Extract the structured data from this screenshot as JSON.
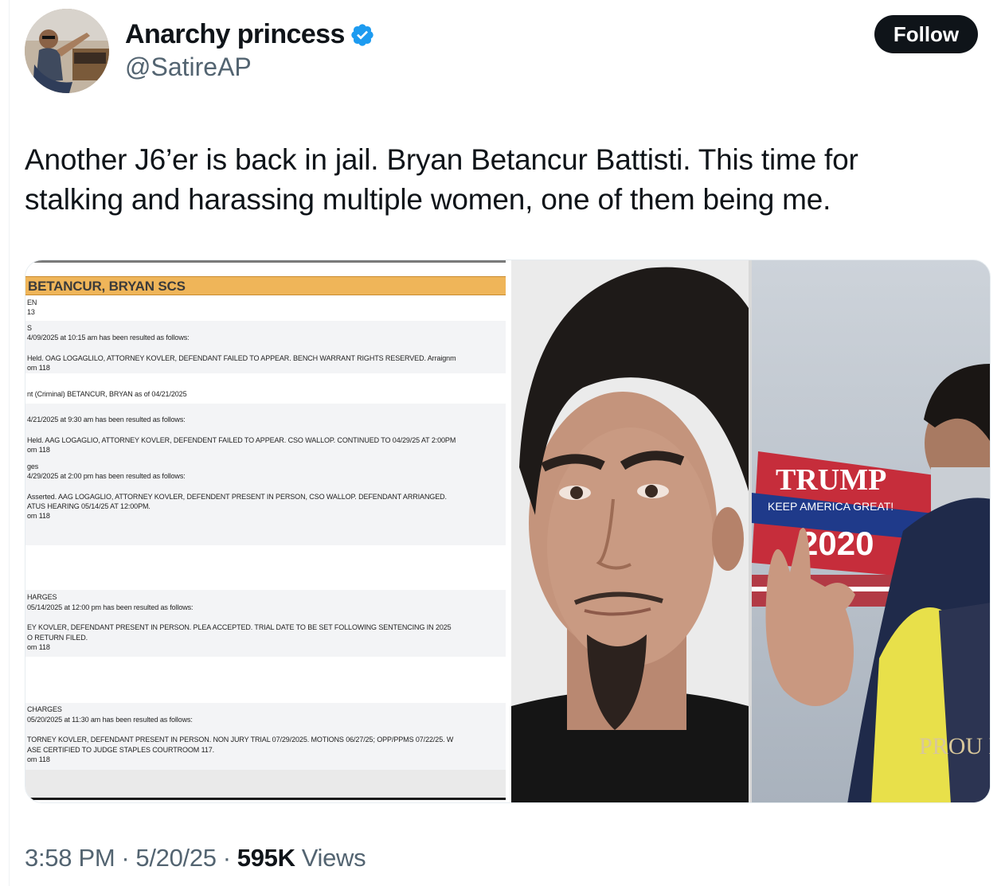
{
  "author": {
    "display_name": "Anarchy princess",
    "handle": "@SatireAP",
    "verified": true
  },
  "follow_label": "Follow",
  "tweet": {
    "text": "Another J6’er is back in jail. Bryan Betancur Battisti. This time for stalking and harassing multiple women, one of them being me."
  },
  "document": {
    "title": "BETANCUR, BRYAN SCS",
    "lines": [
      "EN",
      "13",
      "S",
      "4/09/2025 at 10:15 am has been resulted as follows:",
      "Held. OAG LOGAGLILO, ATTORNEY KOVLER, DEFENDANT FAILED TO APPEAR. BENCH WARRANT RIGHTS RESERVED. Arraignm",
      "om 118",
      "nt (Criminal) BETANCUR, BRYAN as of 04/21/2025",
      "4/21/2025 at 9:30 am has been resulted as follows:",
      "Held. AAG LOGAGLIO, ATTORNEY KOVLER, DEFENDENT FAILED TO APPEAR. CSO WALLOP. CONTINUED TO 04/29/25 AT 2:00PM",
      "om 118",
      "ges",
      "4/29/2025 at 2:00 pm has been resulted as follows:",
      "Asserted.  AAG LOGAGLIO, ATTORNEY KOVLER, DEFENDENT PRESENT IN PERSON, CSO WALLOP. DEFENDANT ARRIANGED.",
      "ATUS HEARING 05/14/25 AT 12:00PM.",
      "om 118",
      "HARGES",
      "05/14/2025 at 12:00 pm has been resulted as follows:",
      "EY KOVLER, DEFENDANT PRESENT IN PERSON. PLEA ACCEPTED. TRIAL DATE TO BE SET FOLLOWING SENTENCING IN 2025",
      "O RETURN FILED.",
      "om 118",
      "CHARGES",
      "05/20/2025 at 11:30 am has been resulted as follows:",
      "TORNEY KOVLER, DEFENDANT PRESENT IN PERSON. NON JURY TRIAL 07/29/2025. MOTIONS 06/27/25; OPP/PPMS 07/22/25. W",
      "ASE CERTIFIED TO JUDGE STAPLES COURTROOM 117.",
      "om 118"
    ]
  },
  "photo_text": {
    "flag_line1": "TRUMP",
    "flag_line2": "KEEP AMERICA GREAT!",
    "flag_line3": "2020",
    "jacket_text": "PROU BOY"
  },
  "meta": {
    "time": "3:58 PM",
    "date": "5/20/25",
    "separator": "·",
    "views_count": "595K",
    "views_label": "Views"
  },
  "colors": {
    "follow_bg": "#0f1419",
    "verified_blue": "#1d9bf0",
    "doc_header": "#efb559",
    "muted_text": "#536471"
  }
}
